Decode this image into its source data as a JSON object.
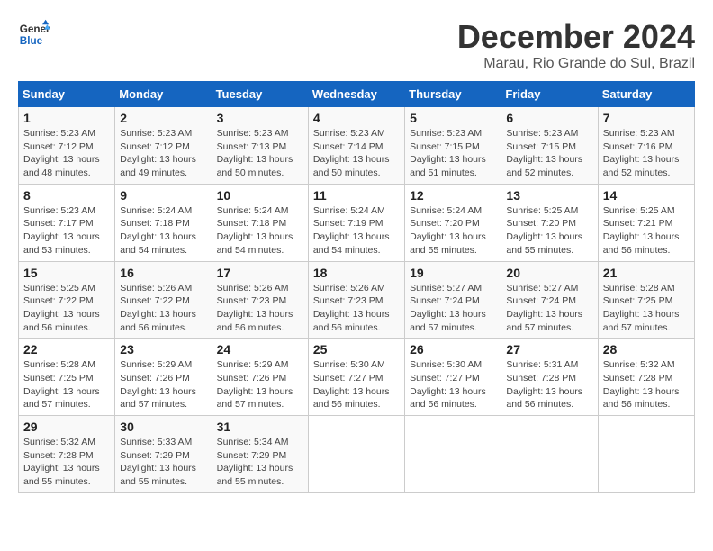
{
  "header": {
    "logo_line1": "General",
    "logo_line2": "Blue",
    "title": "December 2024",
    "subtitle": "Marau, Rio Grande do Sul, Brazil"
  },
  "days_of_week": [
    "Sunday",
    "Monday",
    "Tuesday",
    "Wednesday",
    "Thursday",
    "Friday",
    "Saturday"
  ],
  "weeks": [
    [
      {
        "day": "1",
        "info": "Sunrise: 5:23 AM\nSunset: 7:12 PM\nDaylight: 13 hours and 48 minutes."
      },
      {
        "day": "2",
        "info": "Sunrise: 5:23 AM\nSunset: 7:12 PM\nDaylight: 13 hours and 49 minutes."
      },
      {
        "day": "3",
        "info": "Sunrise: 5:23 AM\nSunset: 7:13 PM\nDaylight: 13 hours and 50 minutes."
      },
      {
        "day": "4",
        "info": "Sunrise: 5:23 AM\nSunset: 7:14 PM\nDaylight: 13 hours and 50 minutes."
      },
      {
        "day": "5",
        "info": "Sunrise: 5:23 AM\nSunset: 7:15 PM\nDaylight: 13 hours and 51 minutes."
      },
      {
        "day": "6",
        "info": "Sunrise: 5:23 AM\nSunset: 7:15 PM\nDaylight: 13 hours and 52 minutes."
      },
      {
        "day": "7",
        "info": "Sunrise: 5:23 AM\nSunset: 7:16 PM\nDaylight: 13 hours and 52 minutes."
      }
    ],
    [
      {
        "day": "8",
        "info": "Sunrise: 5:23 AM\nSunset: 7:17 PM\nDaylight: 13 hours and 53 minutes."
      },
      {
        "day": "9",
        "info": "Sunrise: 5:24 AM\nSunset: 7:18 PM\nDaylight: 13 hours and 54 minutes."
      },
      {
        "day": "10",
        "info": "Sunrise: 5:24 AM\nSunset: 7:18 PM\nDaylight: 13 hours and 54 minutes."
      },
      {
        "day": "11",
        "info": "Sunrise: 5:24 AM\nSunset: 7:19 PM\nDaylight: 13 hours and 54 minutes."
      },
      {
        "day": "12",
        "info": "Sunrise: 5:24 AM\nSunset: 7:20 PM\nDaylight: 13 hours and 55 minutes."
      },
      {
        "day": "13",
        "info": "Sunrise: 5:25 AM\nSunset: 7:20 PM\nDaylight: 13 hours and 55 minutes."
      },
      {
        "day": "14",
        "info": "Sunrise: 5:25 AM\nSunset: 7:21 PM\nDaylight: 13 hours and 56 minutes."
      }
    ],
    [
      {
        "day": "15",
        "info": "Sunrise: 5:25 AM\nSunset: 7:22 PM\nDaylight: 13 hours and 56 minutes."
      },
      {
        "day": "16",
        "info": "Sunrise: 5:26 AM\nSunset: 7:22 PM\nDaylight: 13 hours and 56 minutes."
      },
      {
        "day": "17",
        "info": "Sunrise: 5:26 AM\nSunset: 7:23 PM\nDaylight: 13 hours and 56 minutes."
      },
      {
        "day": "18",
        "info": "Sunrise: 5:26 AM\nSunset: 7:23 PM\nDaylight: 13 hours and 56 minutes."
      },
      {
        "day": "19",
        "info": "Sunrise: 5:27 AM\nSunset: 7:24 PM\nDaylight: 13 hours and 57 minutes."
      },
      {
        "day": "20",
        "info": "Sunrise: 5:27 AM\nSunset: 7:24 PM\nDaylight: 13 hours and 57 minutes."
      },
      {
        "day": "21",
        "info": "Sunrise: 5:28 AM\nSunset: 7:25 PM\nDaylight: 13 hours and 57 minutes."
      }
    ],
    [
      {
        "day": "22",
        "info": "Sunrise: 5:28 AM\nSunset: 7:25 PM\nDaylight: 13 hours and 57 minutes."
      },
      {
        "day": "23",
        "info": "Sunrise: 5:29 AM\nSunset: 7:26 PM\nDaylight: 13 hours and 57 minutes."
      },
      {
        "day": "24",
        "info": "Sunrise: 5:29 AM\nSunset: 7:26 PM\nDaylight: 13 hours and 57 minutes."
      },
      {
        "day": "25",
        "info": "Sunrise: 5:30 AM\nSunset: 7:27 PM\nDaylight: 13 hours and 56 minutes."
      },
      {
        "day": "26",
        "info": "Sunrise: 5:30 AM\nSunset: 7:27 PM\nDaylight: 13 hours and 56 minutes."
      },
      {
        "day": "27",
        "info": "Sunrise: 5:31 AM\nSunset: 7:28 PM\nDaylight: 13 hours and 56 minutes."
      },
      {
        "day": "28",
        "info": "Sunrise: 5:32 AM\nSunset: 7:28 PM\nDaylight: 13 hours and 56 minutes."
      }
    ],
    [
      {
        "day": "29",
        "info": "Sunrise: 5:32 AM\nSunset: 7:28 PM\nDaylight: 13 hours and 55 minutes."
      },
      {
        "day": "30",
        "info": "Sunrise: 5:33 AM\nSunset: 7:29 PM\nDaylight: 13 hours and 55 minutes."
      },
      {
        "day": "31",
        "info": "Sunrise: 5:34 AM\nSunset: 7:29 PM\nDaylight: 13 hours and 55 minutes."
      },
      null,
      null,
      null,
      null
    ]
  ]
}
